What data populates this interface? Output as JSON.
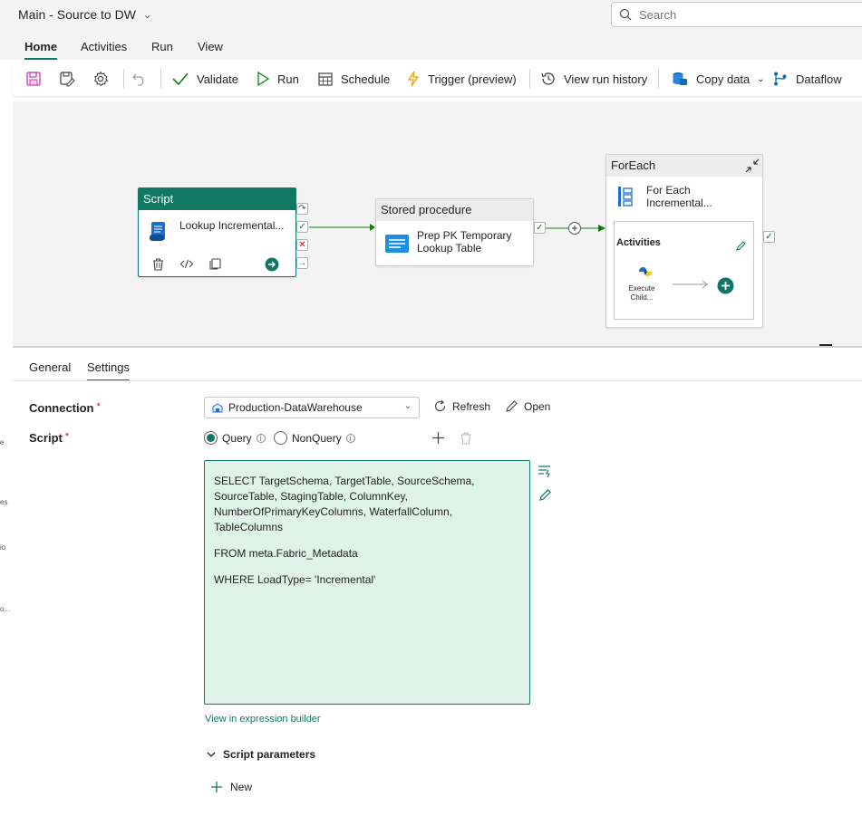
{
  "window": {
    "title": "Main - Source to DW"
  },
  "search": {
    "placeholder": "Search"
  },
  "menu_tabs": [
    {
      "label": "Home",
      "active": true
    },
    {
      "label": "Activities",
      "active": false
    },
    {
      "label": "Run",
      "active": false
    },
    {
      "label": "View",
      "active": false
    }
  ],
  "toolbar": {
    "validate": "Validate",
    "run": "Run",
    "schedule": "Schedule",
    "trigger": "Trigger (preview)",
    "view_run_history": "View run history",
    "copy_data": "Copy data",
    "dataflow": "Dataflow"
  },
  "canvas": {
    "script_node": {
      "header": "Script",
      "name": "Lookup Incremental..."
    },
    "stored_proc_node": {
      "header": "Stored procedure",
      "name_line1": "Prep PK Temporary",
      "name_line2": "Lookup Table"
    },
    "foreach_node": {
      "header": "ForEach",
      "name_line1": "For Each",
      "name_line2": "Incremental...",
      "activities_label": "Activities",
      "inner_line1": "Execute",
      "inner_line2": "Child..."
    }
  },
  "panel_tabs": [
    {
      "label": "General",
      "active": false
    },
    {
      "label": "Settings",
      "active": true
    }
  ],
  "settings": {
    "connection_label": "Connection",
    "connection_value": "Production-DataWarehouse",
    "refresh": "Refresh",
    "open": "Open",
    "script_label": "Script",
    "radio_query": "Query",
    "radio_nonquery": "NonQuery",
    "selected_radio": "Query",
    "sql": {
      "line1": "SELECT TargetSchema, TargetTable, SourceSchema, SourceTable, StagingTable, ColumnKey, NumberOfPrimaryKeyColumns, WaterfallColumn, TableColumns",
      "line2": "FROM meta.Fabric_Metadata",
      "line3": "WHERE LoadType= 'Incremental'"
    },
    "expression_builder": "View in expression builder",
    "script_parameters": "Script parameters",
    "new": "New"
  },
  "left_fragments": [
    "e",
    "es",
    "io",
    "o..."
  ],
  "colors": {
    "accent": "#117865",
    "editor_bg": "#e0f3ea",
    "success": "#107c10",
    "error": "#c50f1f"
  }
}
